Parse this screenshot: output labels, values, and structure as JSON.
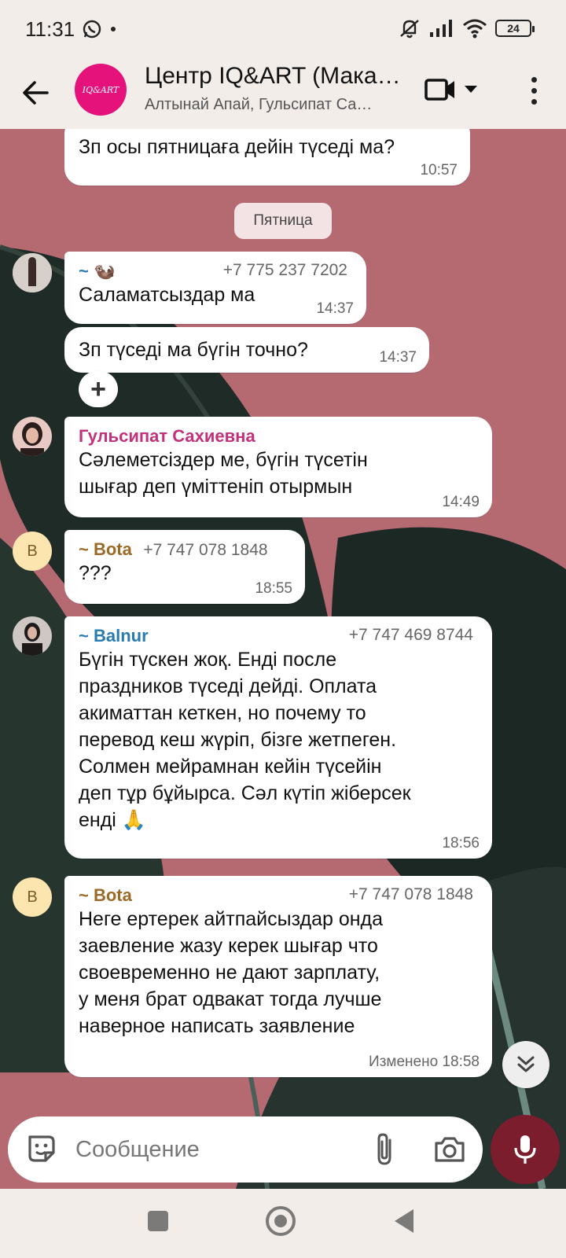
{
  "status_bar": {
    "time": "11:31",
    "battery": "24",
    "icons": [
      "whatsapp-icon",
      "notification-dot-icon",
      "mute-icon",
      "signal-icon",
      "wifi-icon",
      "battery-icon"
    ]
  },
  "header": {
    "title": "Центр IQ&ART (Мака…",
    "subtitle": "Алтынай Апай, Гульсипат Са…",
    "avatar_text": "IQ&ART",
    "avatar_color": "#e4127a"
  },
  "colors": {
    "chat_bg": "#b56a72",
    "accent": "#7c1d2e",
    "sender_gulsipat": "#c2317a",
    "sender_bota": "#9b6a27",
    "sender_balnur": "#2a7bb0"
  },
  "date_separator": "Пятница",
  "messages": [
    {
      "text": "Зп осы пятницаға дейін түседі ма?",
      "time": "10:57"
    },
    {
      "sender": "~ 🦦",
      "phone": "+7 775 237 7202",
      "text": "Саламатсыздар ма",
      "time": "14:37"
    },
    {
      "text": "Зп түседі ма бүгін точно?",
      "time": "14:37"
    },
    {
      "sender": "Гульсипат Сахиевна",
      "lines": [
        "Сәлеметсіздер ме, бүгін түсетін",
        "шығар деп үміттеніп отырмын"
      ],
      "time": "14:49"
    },
    {
      "sender": "~ Bota",
      "phone": "+7 747 078 1848",
      "text": "???",
      "time": "18:55",
      "avatar_letter": "B"
    },
    {
      "sender": "~ Balnur",
      "phone": "+7 747 469 8744",
      "lines": [
        "Бүгін түскен жоқ. Енді после",
        "праздников түседі дейді. Оплата",
        "акиматтан кеткен, но почему то",
        "перевод кеш жүріп, бізге жетпеген.",
        "Солмен мейрамнан кейін түсейін",
        "деп тұр бұйырса. Сәл күтіп жіберсек",
        "енді 🙏"
      ],
      "time": "18:56"
    },
    {
      "sender": "~ Bota",
      "phone": "+7 747 078 1848",
      "lines": [
        "Неге ертерек айтпайсыздар онда",
        "заевление жазу керек шығар что",
        "своевременно не дают зарплату,",
        "у меня брат одвакат тогда лучше",
        "наверное написать заявление"
      ],
      "time": "Изменено 18:58",
      "avatar_letter": "B"
    }
  ],
  "reaction_button": "+",
  "input": {
    "placeholder": "Сообщение"
  }
}
